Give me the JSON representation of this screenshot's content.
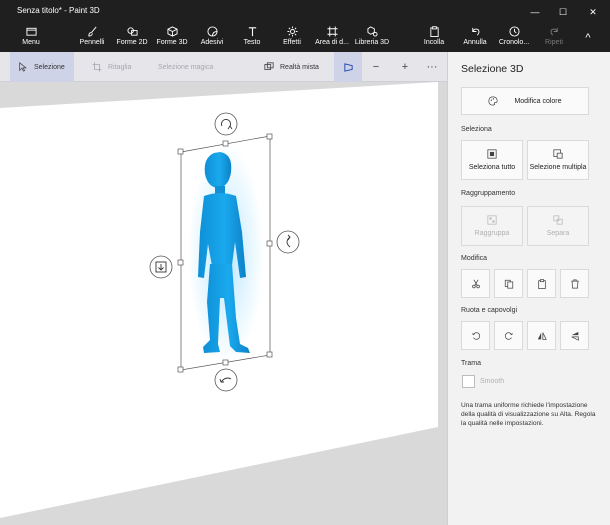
{
  "window": {
    "title": "Senza titolo* - Paint 3D",
    "minimize_glyph": "—",
    "maximize_glyph": "☐",
    "close_glyph": "✕"
  },
  "ribbon": {
    "menu": "Menu",
    "brushes": "Pennelli",
    "shapes2d": "Forme 2D",
    "shapes3d": "Forme 3D",
    "stickers": "Adesivi",
    "text": "Testo",
    "effects": "Effetti",
    "canvas": "Area di d...",
    "library3d": "Libreria 3D",
    "paste": "Incolla",
    "undo": "Annulla",
    "history": "Cronolo...",
    "redo": "Ripeti",
    "collapse_glyph": "^"
  },
  "toolbar": {
    "select": "Selezione",
    "crop": "Ritaglia",
    "magic_select": "Selezione magica",
    "mixed_reality": "Realtà mista",
    "zoom_out_glyph": "−",
    "zoom_in_glyph": "+",
    "more_glyph": "···"
  },
  "panel": {
    "title": "Selezione 3D",
    "edit_color": "Modifica colore",
    "select_section": "Seleziona",
    "select_all": "Seleziona tutto",
    "multi_select": "Selezione multipla",
    "group_section": "Raggruppamento",
    "group": "Raggruppa",
    "ungroup": "Separa",
    "edit_section": "Modifica",
    "rotate_section": "Ruota e capovolgi",
    "texture_section": "Trama",
    "smooth": "Smooth",
    "description": "Una trama uniforme richiede l'impostazione della qualità di visualizzazione su Alta. Regola la qualità nelle impostazioni."
  },
  "colors": {
    "accent": "#0078d7",
    "figure": "#1aa3e8",
    "dark_bar": "#1f1f1f",
    "panel_bg": "#f2f2f2"
  },
  "state": {
    "smooth_checked": false,
    "active_tool": "Selezione"
  }
}
